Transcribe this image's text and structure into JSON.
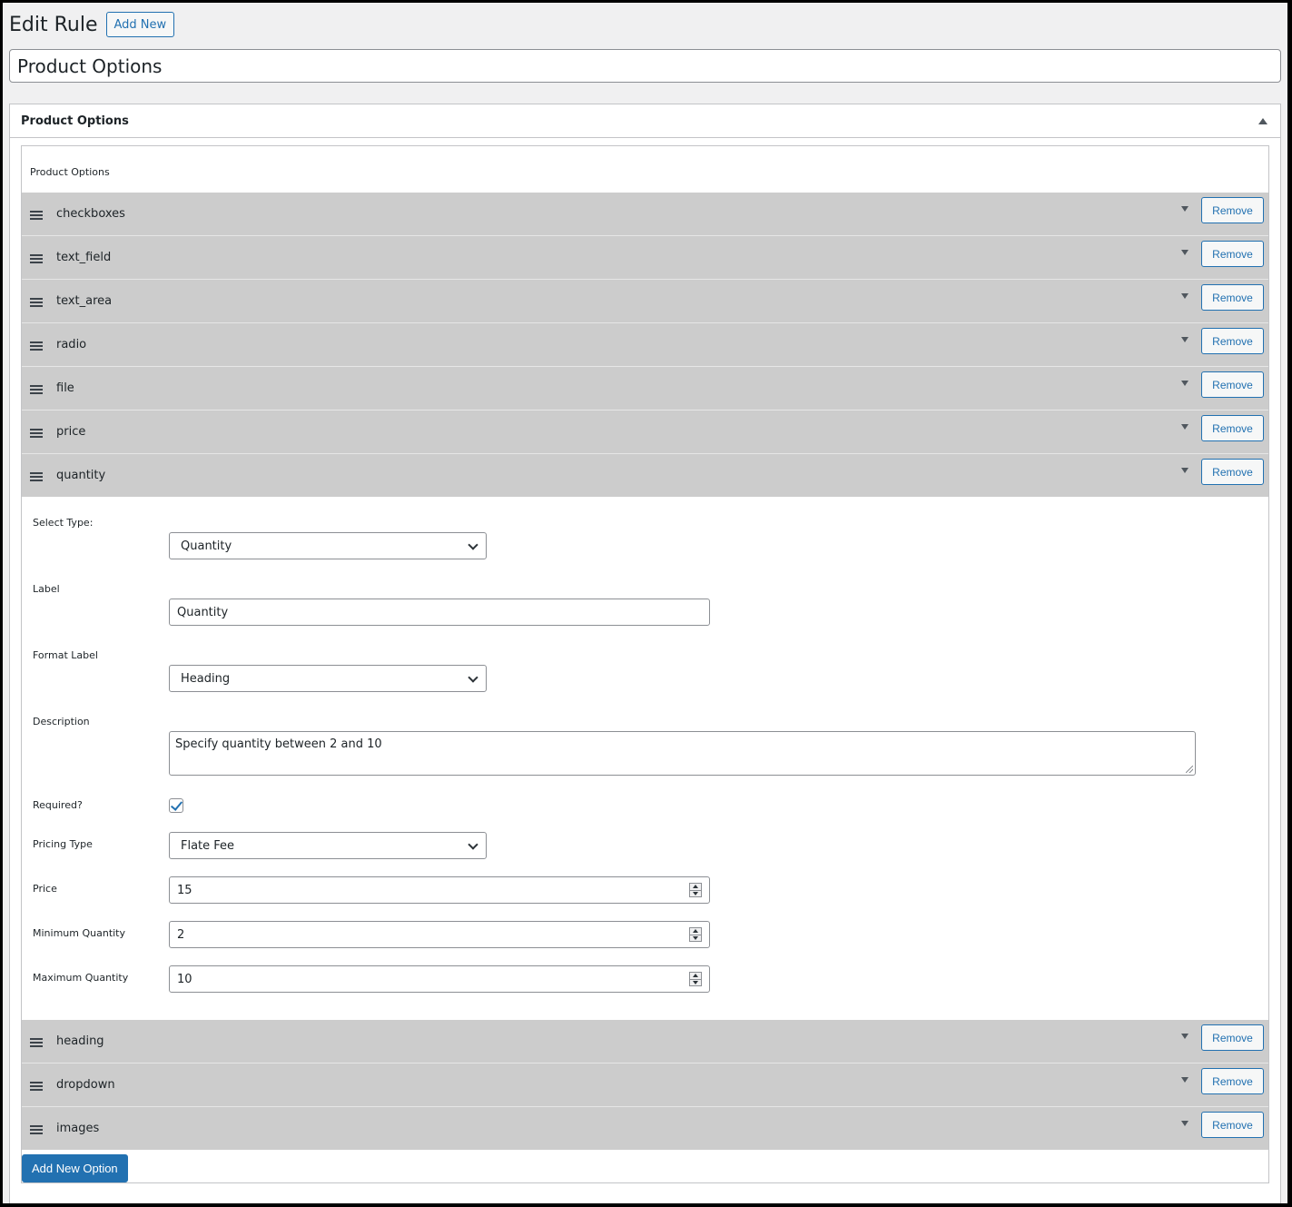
{
  "header": {
    "title": "Edit Rule",
    "add_new_label": "Add New"
  },
  "post_title": "Product Options",
  "metabox": {
    "title": "Product Options",
    "inner_label": "Product Options"
  },
  "remove_label": "Remove",
  "options_before": [
    "checkboxes",
    "text_field",
    "text_area",
    "radio",
    "file",
    "price",
    "quantity"
  ],
  "options_after": [
    "heading",
    "dropdown",
    "images"
  ],
  "detail": {
    "select_type_label": "Select Type:",
    "select_type_value": "Quantity",
    "label_label": "Label",
    "label_value": "Quantity",
    "format_label_label": "Format Label",
    "format_label_value": "Heading",
    "description_label": "Description",
    "description_value": "Specify quantity between 2 and 10",
    "required_label": "Required?",
    "required_checked": true,
    "pricing_type_label": "Pricing Type",
    "pricing_type_value": "Flate Fee",
    "price_label": "Price",
    "price_value": "15",
    "min_qty_label": "Minimum Quantity",
    "min_qty_value": "2",
    "max_qty_label": "Maximum Quantity",
    "max_qty_value": "10"
  },
  "add_option_label": "Add New Option",
  "colors": {
    "accent": "#2271b1",
    "row_bg": "#cccccc",
    "page_bg": "#f0f0f1"
  }
}
